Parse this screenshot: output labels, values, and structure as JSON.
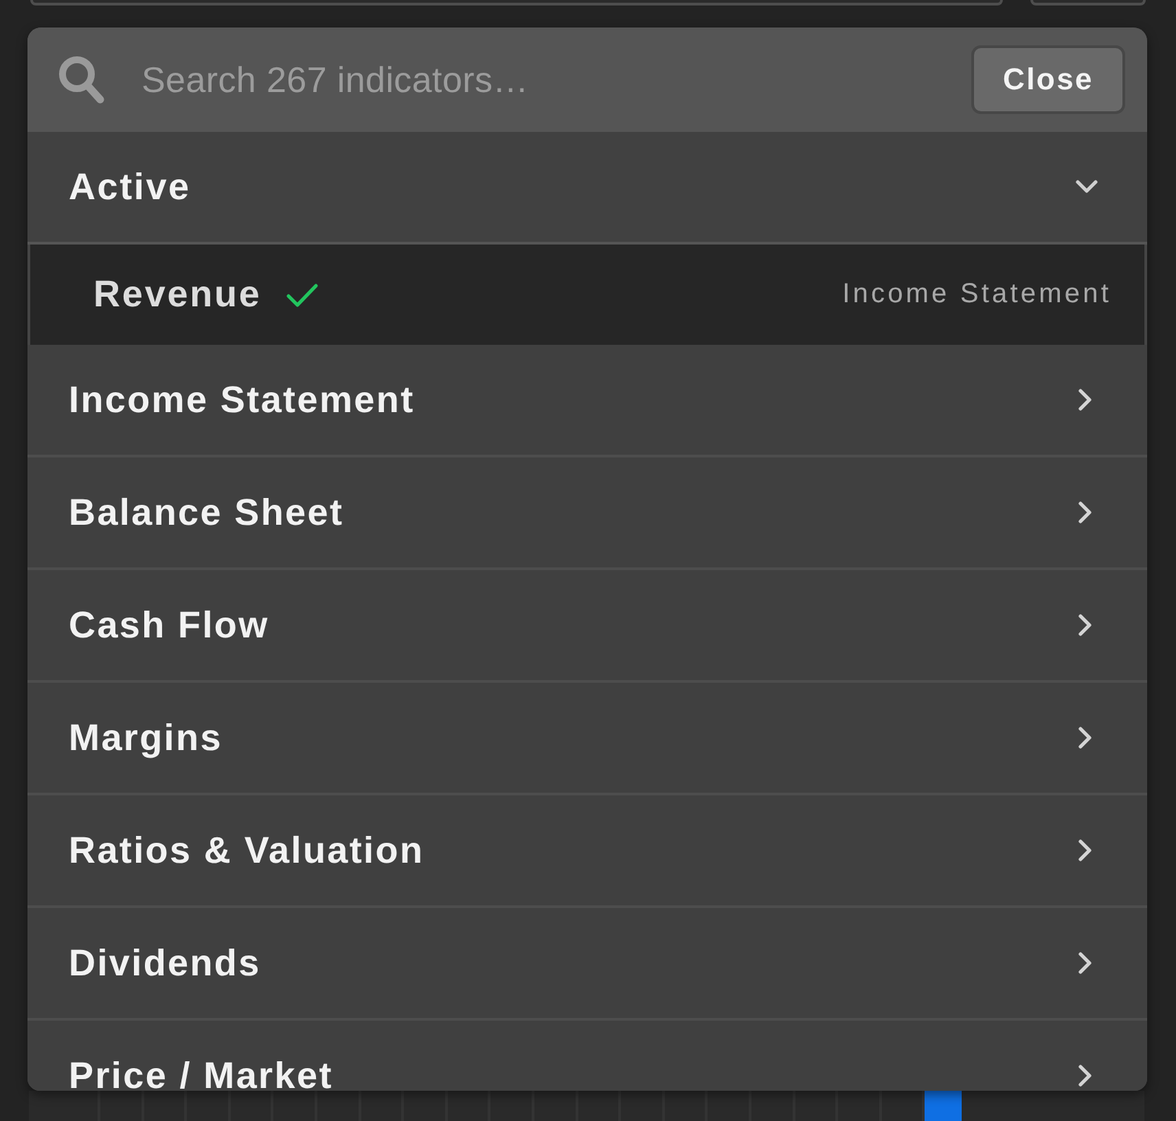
{
  "search": {
    "placeholder": "Search 267 indicators…",
    "close_label": "Close"
  },
  "active_group": {
    "title": "Active",
    "expanded": true,
    "items": [
      {
        "name": "Revenue",
        "category": "Income Statement",
        "checked": true
      }
    ]
  },
  "categories": [
    {
      "label": "Income Statement"
    },
    {
      "label": "Balance Sheet"
    },
    {
      "label": "Cash Flow"
    },
    {
      "label": "Margins"
    },
    {
      "label": "Ratios & Valuation"
    },
    {
      "label": "Dividends"
    },
    {
      "label": "Price / Market"
    }
  ],
  "background_grid": {
    "cells": [
      {
        "highlighted": false
      },
      {
        "highlighted": false
      },
      {
        "highlighted": false
      },
      {
        "highlighted": false
      },
      {
        "highlighted": false
      },
      {
        "highlighted": false
      },
      {
        "highlighted": false
      },
      {
        "highlighted": false
      },
      {
        "highlighted": false
      },
      {
        "highlighted": false
      },
      {
        "highlighted": false
      },
      {
        "highlighted": false
      },
      {
        "highlighted": false
      },
      {
        "highlighted": false
      },
      {
        "highlighted": false
      },
      {
        "highlighted": false
      },
      {
        "highlighted": false
      },
      {
        "highlighted": false
      },
      {
        "highlighted": false
      },
      {
        "highlighted": false
      },
      {
        "highlighted": true
      }
    ]
  }
}
